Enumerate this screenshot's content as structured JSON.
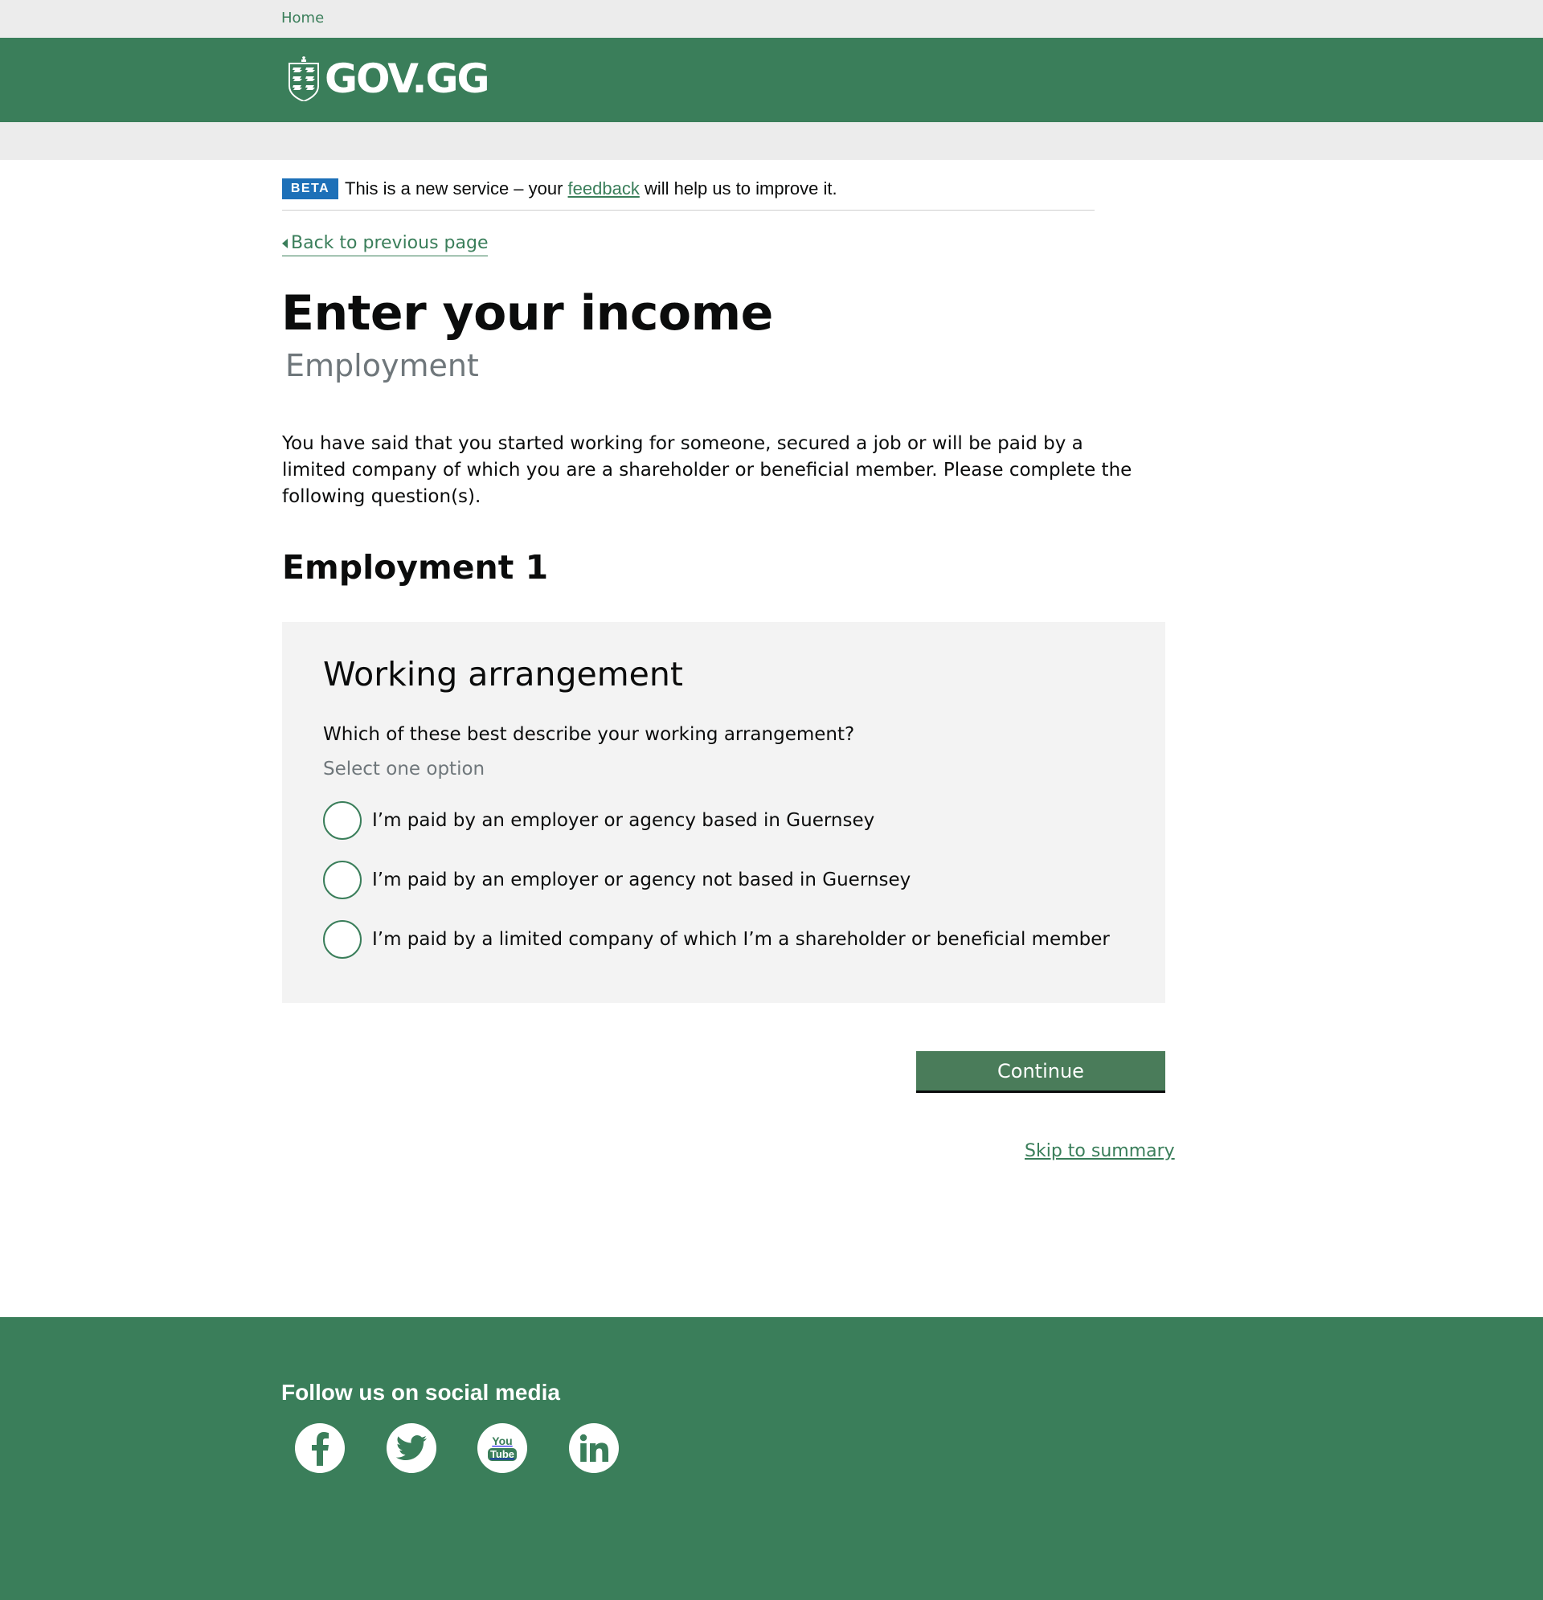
{
  "topbar": {
    "home_link": "Home"
  },
  "header": {
    "logo_text": "GOV.GG",
    "logo_icon": "guernsey-crest-icon"
  },
  "beta_banner": {
    "tag": "BETA",
    "text_before": "This is a new service – your ",
    "link": "feedback",
    "text_after": " will help us to improve it."
  },
  "back_link": "Back to previous page",
  "page": {
    "title": "Enter your income",
    "caption": "Employment",
    "intro": "You have said that you started working for someone, secured a job or will be paid by a limited company of which you are a shareholder or beneficial member. Please complete the following question(s).",
    "section_heading": "Employment 1"
  },
  "panel": {
    "heading": "Working arrangement",
    "question": "Which of these best describe your working arrangement?",
    "hint": "Select one option",
    "options": [
      {
        "label": "I’m paid by an employer or agency based in Guernsey",
        "selected": false
      },
      {
        "label": "I’m paid by an employer or agency not based in Guernsey",
        "selected": false
      },
      {
        "label": "I’m paid by a limited company of which I’m a shareholder or beneficial member",
        "selected": false
      }
    ]
  },
  "actions": {
    "continue_label": "Continue",
    "skip_label": "Skip to summary"
  },
  "footer": {
    "follow_heading": "Follow us on social media",
    "social": [
      {
        "icon": "facebook-icon"
      },
      {
        "icon": "twitter-icon"
      },
      {
        "icon": "youtube-icon",
        "text_top": "You",
        "text_bottom": "Tube"
      },
      {
        "icon": "linkedin-icon"
      }
    ]
  },
  "colors": {
    "brand_green": "#3a7e5a",
    "button_green": "#4a7c5a",
    "beta_blue": "#1d70b8",
    "panel_grey": "#f3f3f3",
    "bar_grey": "#ececec",
    "hint_grey": "#6f777b"
  }
}
